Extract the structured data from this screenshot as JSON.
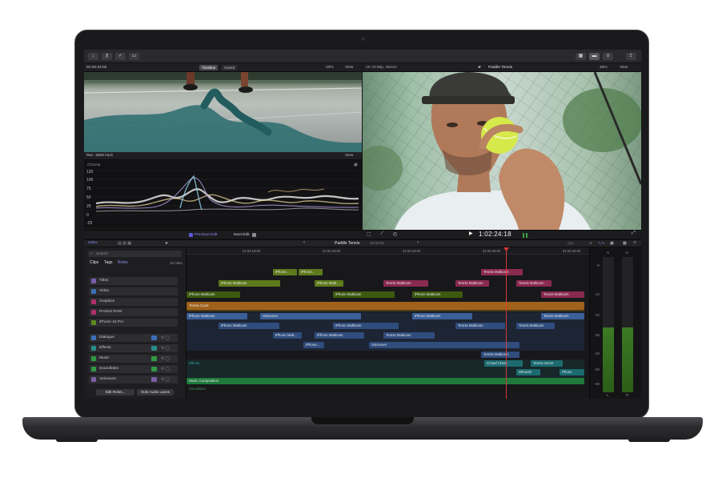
{
  "toolbar": {
    "left_icons": [
      "import-icon",
      "key-icon",
      "check-icon",
      "tag-icon"
    ],
    "right_icons": [
      "grid-icon",
      "window-icon",
      "inspector-icon",
      "share-icon"
    ]
  },
  "browser_viewer": {
    "timecode": "01:02:24:02",
    "tab_timeline": "Timeline",
    "tab_saved": "Saved",
    "zoom": "23%",
    "view": "View"
  },
  "scope": {
    "title": "Rec. 2020 HLG",
    "view": "View",
    "mode": "Chroma",
    "scale": [
      "120",
      "100",
      "75",
      "50",
      "25",
      "0",
      "-25"
    ]
  },
  "main_viewer": {
    "format": "4K 23.98p, Stereo",
    "title": "Paddle Tennis",
    "zoom": "45%",
    "view": "View"
  },
  "edit_nav": {
    "prev": "Previous Edit",
    "next": "Next Edit"
  },
  "transport": {
    "timecode": "1:02:24:18"
  },
  "timeline_bar": {
    "index": "Index",
    "project": "Paddle Tennis",
    "duration": "24:00:01"
  },
  "index_panel": {
    "search_placeholder": "Search",
    "tabs": [
      "Clips",
      "Tags",
      "Roles"
    ],
    "count": "15 roles",
    "roles": [
      {
        "label": "Titles",
        "color": "#7b5ea8"
      },
      {
        "label": "Video",
        "color": "#3d6fb8"
      },
      {
        "label": "Graphics",
        "color": "#b0306a"
      },
      {
        "label": "ProRes RAW",
        "color": "#b0306a"
      },
      {
        "label": "iPhone 15 Pro",
        "color": "#5e8a1e"
      }
    ],
    "audio_roles": [
      {
        "label": "Dialogue",
        "color": "#3d6fb8"
      },
      {
        "label": "Effects",
        "color": "#2a8c8a"
      },
      {
        "label": "Music",
        "color": "#2f9a44"
      },
      {
        "label": "Soundbites",
        "color": "#2f9a44"
      },
      {
        "label": "Voiceover",
        "color": "#7b5ea8"
      }
    ],
    "edit_roles": "Edit Roles...",
    "hide_lanes": "Hide Audio Lanes"
  },
  "ruler": [
    "01:02:16:00",
    "01:02:20:00",
    "01:02:24:00",
    "01:02:28:00",
    "01:02:32:00"
  ],
  "clips": {
    "iphone": "iPhone...",
    "iphone_multicam": "iPhone Multicam",
    "iphone_multi": "iPhone Multi...",
    "iphone_mult": "iPhone Mult...",
    "iphone_short": "iPhone...",
    "tennis_multicam": "Tennis Multicam",
    "tennis_court": "Tennis Court",
    "voiceover": "Voiceover",
    "effects": "Effects",
    "crowd_cheer": "Crowd Cheer",
    "tennis_serve": "Tennis Serve",
    "whoosh": "Whoosh",
    "phone": "Phone",
    "music": "Music Composition",
    "soundbites": "Soundbites"
  },
  "meters": {
    "scale": [
      "-6",
      "-12",
      "-20",
      "-30",
      "-40",
      "-50",
      "-60"
    ],
    "top": "-6",
    "channels": [
      "L",
      "R"
    ],
    "level_left": 0.48,
    "level_right": 0.48
  }
}
